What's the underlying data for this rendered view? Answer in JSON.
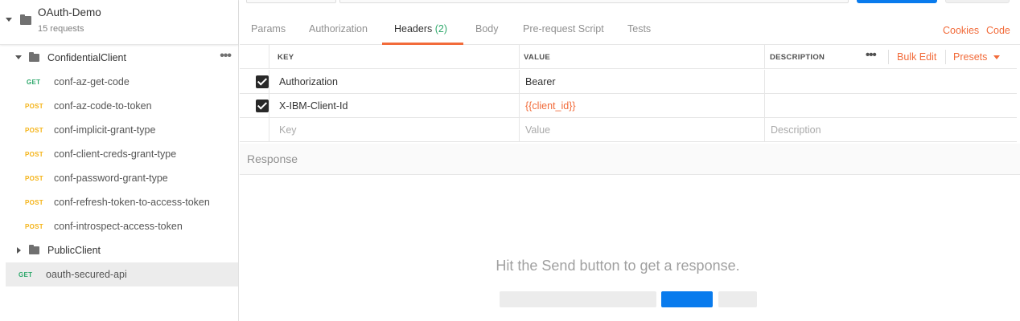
{
  "collection": {
    "name": "OAuth-Demo",
    "request_count": "15 requests",
    "folders": [
      {
        "name": "ConfidentialClient",
        "expanded": true,
        "requests": [
          {
            "method": "GET",
            "name": "conf-az-get-code"
          },
          {
            "method": "POST",
            "name": "conf-az-code-to-token"
          },
          {
            "method": "POST",
            "name": "conf-implicit-grant-type"
          },
          {
            "method": "POST",
            "name": "conf-client-creds-grant-type"
          },
          {
            "method": "POST",
            "name": "conf-password-grant-type"
          },
          {
            "method": "POST",
            "name": "conf-refresh-token-to-access-token"
          },
          {
            "method": "POST",
            "name": "conf-introspect-access-token"
          }
        ]
      },
      {
        "name": "PublicClient",
        "expanded": false
      }
    ],
    "root_requests": [
      {
        "method": "GET",
        "name": "oauth-secured-api",
        "selected": true
      }
    ]
  },
  "request_tabs": {
    "items": [
      "Params",
      "Authorization",
      "Headers",
      "Body",
      "Pre-request Script",
      "Tests"
    ],
    "active": "Headers",
    "headers_count": "(2)",
    "cookies_label": "Cookies",
    "code_label": "Code"
  },
  "headers_table": {
    "columns": {
      "key": "KEY",
      "value": "VALUE",
      "description": "DESCRIPTION"
    },
    "more_icon": "•••",
    "bulk_edit_label": "Bulk Edit",
    "presets_label": "Presets",
    "rows": [
      {
        "checked": true,
        "key": "Authorization",
        "value": "Bearer",
        "description": ""
      },
      {
        "checked": true,
        "key": "X-IBM-Client-Id",
        "value": "{{client_id}}",
        "description": ""
      }
    ],
    "placeholders": {
      "key": "Key",
      "value": "Value",
      "description": "Description"
    }
  },
  "response": {
    "label": "Response",
    "empty_message": "Hit the Send button to get a response."
  },
  "colors": {
    "accent": "#f26b3a",
    "get": "#2ea86b",
    "post": "#f5b316",
    "send": "#097bed"
  }
}
